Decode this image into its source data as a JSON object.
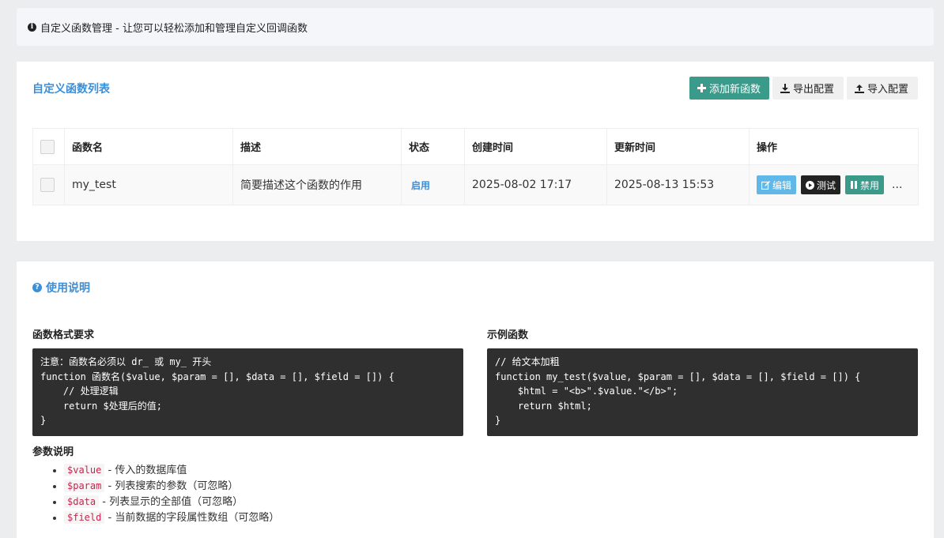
{
  "notice": {
    "text": "自定义函数管理 - 让您可以轻松添加和管理自定义回调函数"
  },
  "list_panel": {
    "title": "自定义函数列表",
    "buttons": {
      "add": "添加新函数",
      "export": "导出配置",
      "import": "导入配置"
    },
    "table": {
      "headers": [
        "函数名",
        "描述",
        "状态",
        "创建时间",
        "更新时间",
        "操作"
      ],
      "rows": [
        {
          "name": "my_test",
          "description": "简要描述这个函数的作用",
          "status": "启用",
          "created": "2025-08-02 17:17",
          "updated": "2025-08-13 15:53",
          "actions": {
            "edit": "编辑",
            "test": "测试",
            "disable": "禁用",
            "more": "..."
          }
        }
      ]
    }
  },
  "help_panel": {
    "title": "使用说明",
    "format_title": "函数格式要求",
    "format_code": "注意：函数名必须以 dr_ 或 my_ 开头\nfunction 函数名($value, $param = [], $data = [], $field = []) {\n    // 处理逻辑\n    return $处理后的值;\n}",
    "example_title": "示例函数",
    "example_code": "// 给文本加粗\nfunction my_test($value, $param = [], $data = [], $field = []) {\n    $html = \"<b>\".$value.\"</b>\";\n    return $html;\n}",
    "params_title": "参数说明",
    "params": [
      {
        "var": "$value",
        "desc": " - 传入的数据库值"
      },
      {
        "var": "$param",
        "desc": " - 列表搜索的参数（可忽略）"
      },
      {
        "var": "$data",
        "desc": " - 列表显示的全部值（可忽略）"
      },
      {
        "var": "$field",
        "desc": " - 当前数据的字段属性数组（可忽略）"
      }
    ]
  },
  "icons": {
    "notice": "info-circle-icon",
    "add": "plus-icon",
    "export": "download-icon",
    "import": "upload-icon",
    "edit": "edit-icon",
    "test": "play-icon",
    "disable": "pause-icon",
    "help": "question-circle-icon"
  },
  "colors": {
    "accent": "#3b8fd8",
    "success": "#3a9b8b",
    "info": "#5fb8e8",
    "dark": "#222222"
  }
}
